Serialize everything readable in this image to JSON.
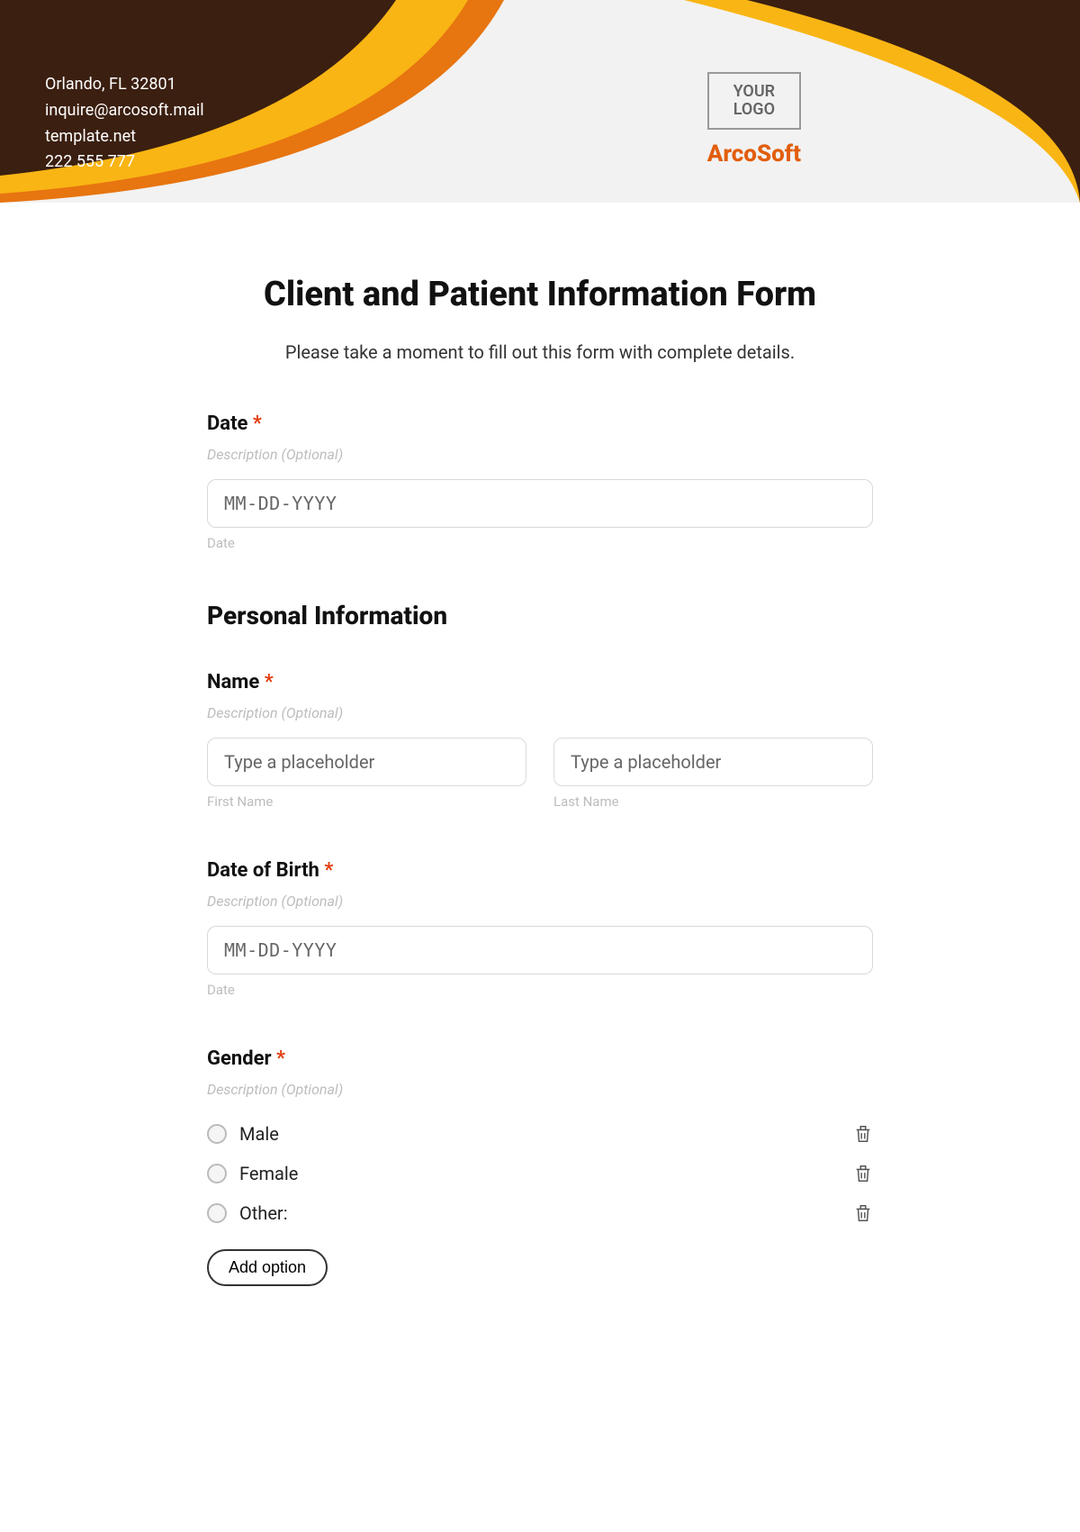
{
  "header": {
    "contact": {
      "address": "Orlando, FL 32801",
      "email": "inquire@arcosoft.mail",
      "website": "template.net",
      "phone": "222 555 777"
    },
    "logo_line1": "YOUR",
    "logo_line2": "LOGO",
    "brand": "ArcoSoft"
  },
  "form": {
    "title": "Client and Patient Information Form",
    "subtitle": "Please take a moment to fill out this form with complete details."
  },
  "fields": {
    "date": {
      "label": "Date",
      "required": "*",
      "description": "Description (Optional)",
      "placeholder": "MM-DD-YYYY",
      "sublabel": "Date"
    },
    "personal_section": "Personal Information",
    "name": {
      "label": "Name",
      "required": "*",
      "description": "Description (Optional)",
      "first_placeholder": "Type a placeholder",
      "first_sublabel": "First Name",
      "last_placeholder": "Type a placeholder",
      "last_sublabel": "Last Name"
    },
    "dob": {
      "label": "Date of Birth",
      "required": "*",
      "description": "Description (Optional)",
      "placeholder": "MM-DD-YYYY",
      "sublabel": "Date"
    },
    "gender": {
      "label": "Gender",
      "required": "*",
      "description": "Description (Optional)",
      "options": [
        "Male",
        "Female",
        "Other:"
      ],
      "add_label": "Add option"
    }
  }
}
